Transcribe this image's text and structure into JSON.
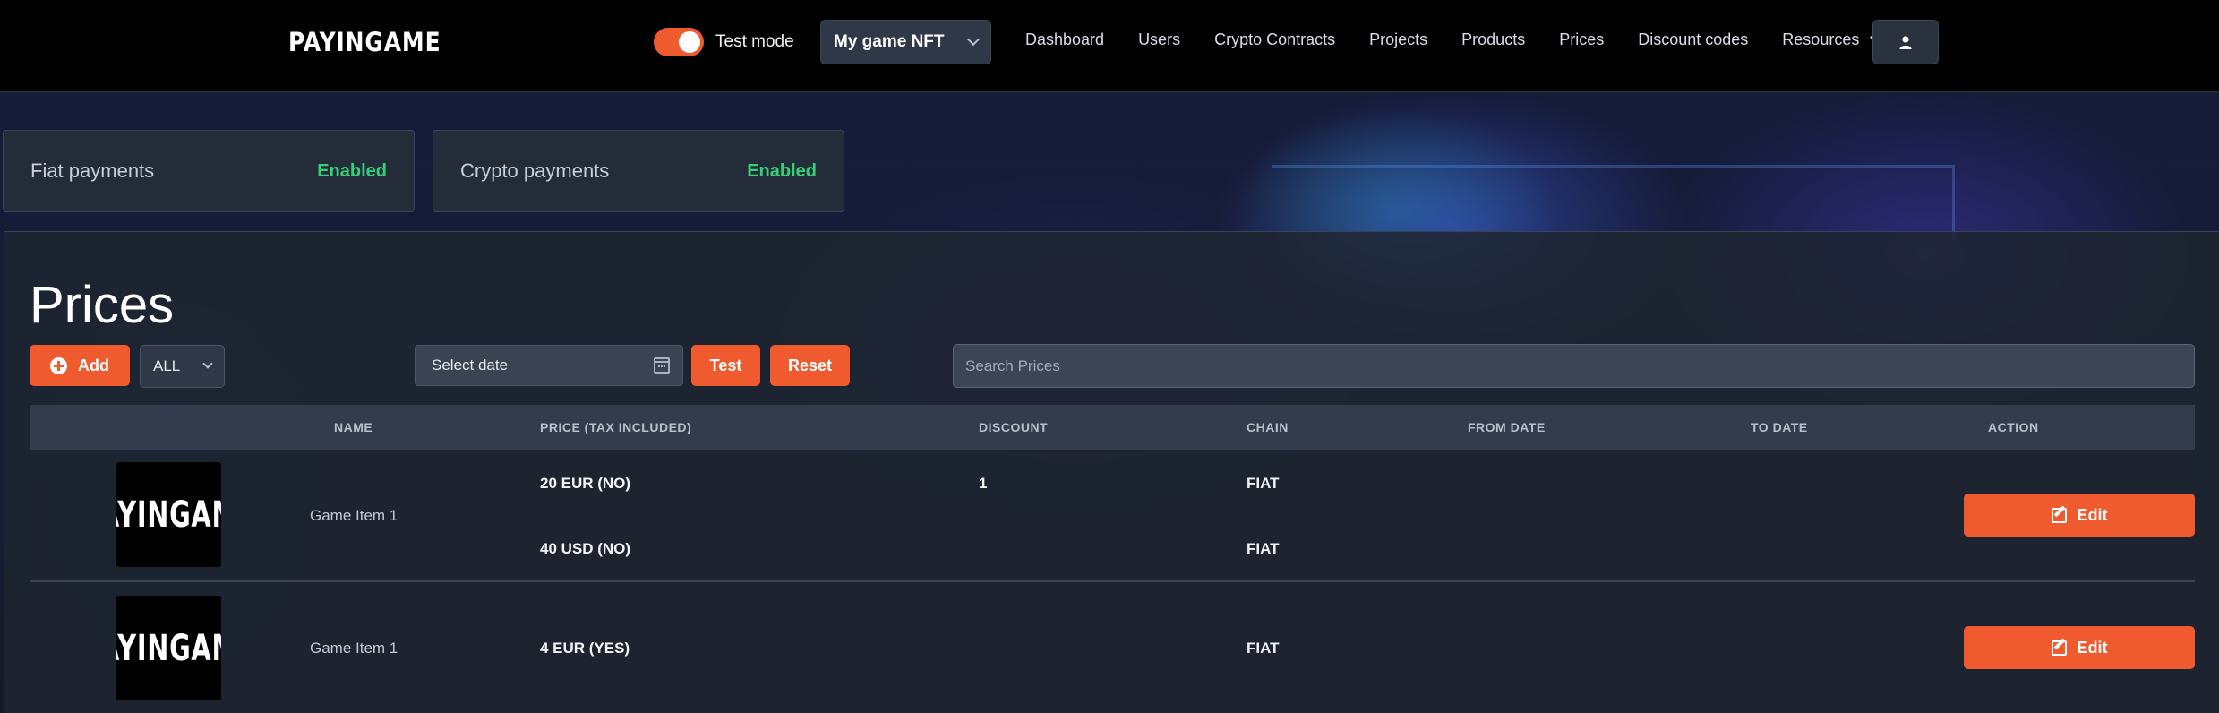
{
  "header": {
    "logo": "PAYINGAME",
    "test_mode_label": "Test mode",
    "test_mode_on": true,
    "project_select": "My game NFT",
    "nav": [
      "Dashboard",
      "Users",
      "Crypto Contracts",
      "Projects",
      "Products",
      "Prices",
      "Discount codes",
      "Resources"
    ]
  },
  "cards": [
    {
      "title": "Fiat payments",
      "status": "Enabled"
    },
    {
      "title": "Crypto payments",
      "status": "Enabled"
    }
  ],
  "main": {
    "title": "Prices",
    "add_label": "Add",
    "filter_value": "ALL",
    "date_placeholder": "Select date",
    "test_label": "Test",
    "reset_label": "Reset",
    "search_placeholder": "Search Prices"
  },
  "table": {
    "headers": [
      "NAME",
      "PRICE (TAX INCLUDED)",
      "DISCOUNT",
      "CHAIN",
      "FROM DATE",
      "TO DATE",
      "ACTION"
    ],
    "rows": [
      {
        "thumb_text": "PAYINGAME",
        "name": "Game Item 1",
        "prices": [
          "20 EUR (NO)",
          "40 USD (NO)"
        ],
        "discount": "1",
        "chains": [
          "FIAT",
          "FIAT"
        ],
        "action": "Edit"
      },
      {
        "thumb_text": "PAYINGAME",
        "name": "Game Item 1",
        "prices": [
          "4 EUR (YES)"
        ],
        "discount": "",
        "chains": [
          "FIAT"
        ],
        "action": "Edit"
      }
    ]
  },
  "colors": {
    "accent": "#f05a2f",
    "enabled": "#35d17a",
    "header_bg": "#000000"
  }
}
